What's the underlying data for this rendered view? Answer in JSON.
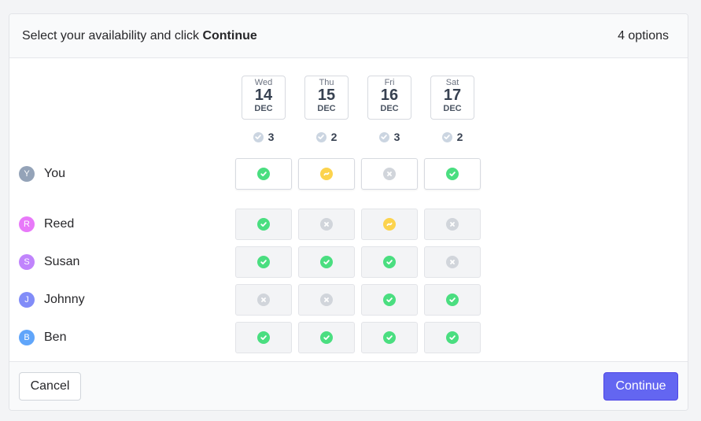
{
  "header": {
    "prompt_prefix": "Select your availability and click",
    "prompt_strong": "Continue",
    "options_count": "4 options"
  },
  "dates": [
    {
      "dow": "Wed",
      "day": "14",
      "month": "DEC",
      "score": "3"
    },
    {
      "dow": "Thu",
      "day": "15",
      "month": "DEC",
      "score": "2"
    },
    {
      "dow": "Fri",
      "day": "16",
      "month": "DEC",
      "score": "3"
    },
    {
      "dow": "Sat",
      "day": "17",
      "month": "DEC",
      "score": "2"
    }
  ],
  "participants": [
    {
      "initial": "Y",
      "name": "You",
      "avatar_color": "#94a3b8",
      "votes": [
        "yes",
        "ifneedbe",
        "no",
        "yes"
      ]
    },
    {
      "initial": "R",
      "name": "Reed",
      "avatar_color": "#e879f9",
      "votes": [
        "yes",
        "no",
        "ifneedbe",
        "no"
      ]
    },
    {
      "initial": "S",
      "name": "Susan",
      "avatar_color": "#c084fc",
      "votes": [
        "yes",
        "yes",
        "yes",
        "no"
      ]
    },
    {
      "initial": "J",
      "name": "Johnny",
      "avatar_color": "#818cf8",
      "votes": [
        "no",
        "no",
        "yes",
        "yes"
      ]
    },
    {
      "initial": "B",
      "name": "Ben",
      "avatar_color": "#60a5fa",
      "votes": [
        "yes",
        "yes",
        "yes",
        "yes"
      ]
    }
  ],
  "footer": {
    "cancel_label": "Cancel",
    "continue_label": "Continue"
  },
  "colors": {
    "accent": "#6366f1",
    "yes": "#4ade80",
    "ifneedbe": "#fcd34d",
    "no": "#d1d5db"
  }
}
